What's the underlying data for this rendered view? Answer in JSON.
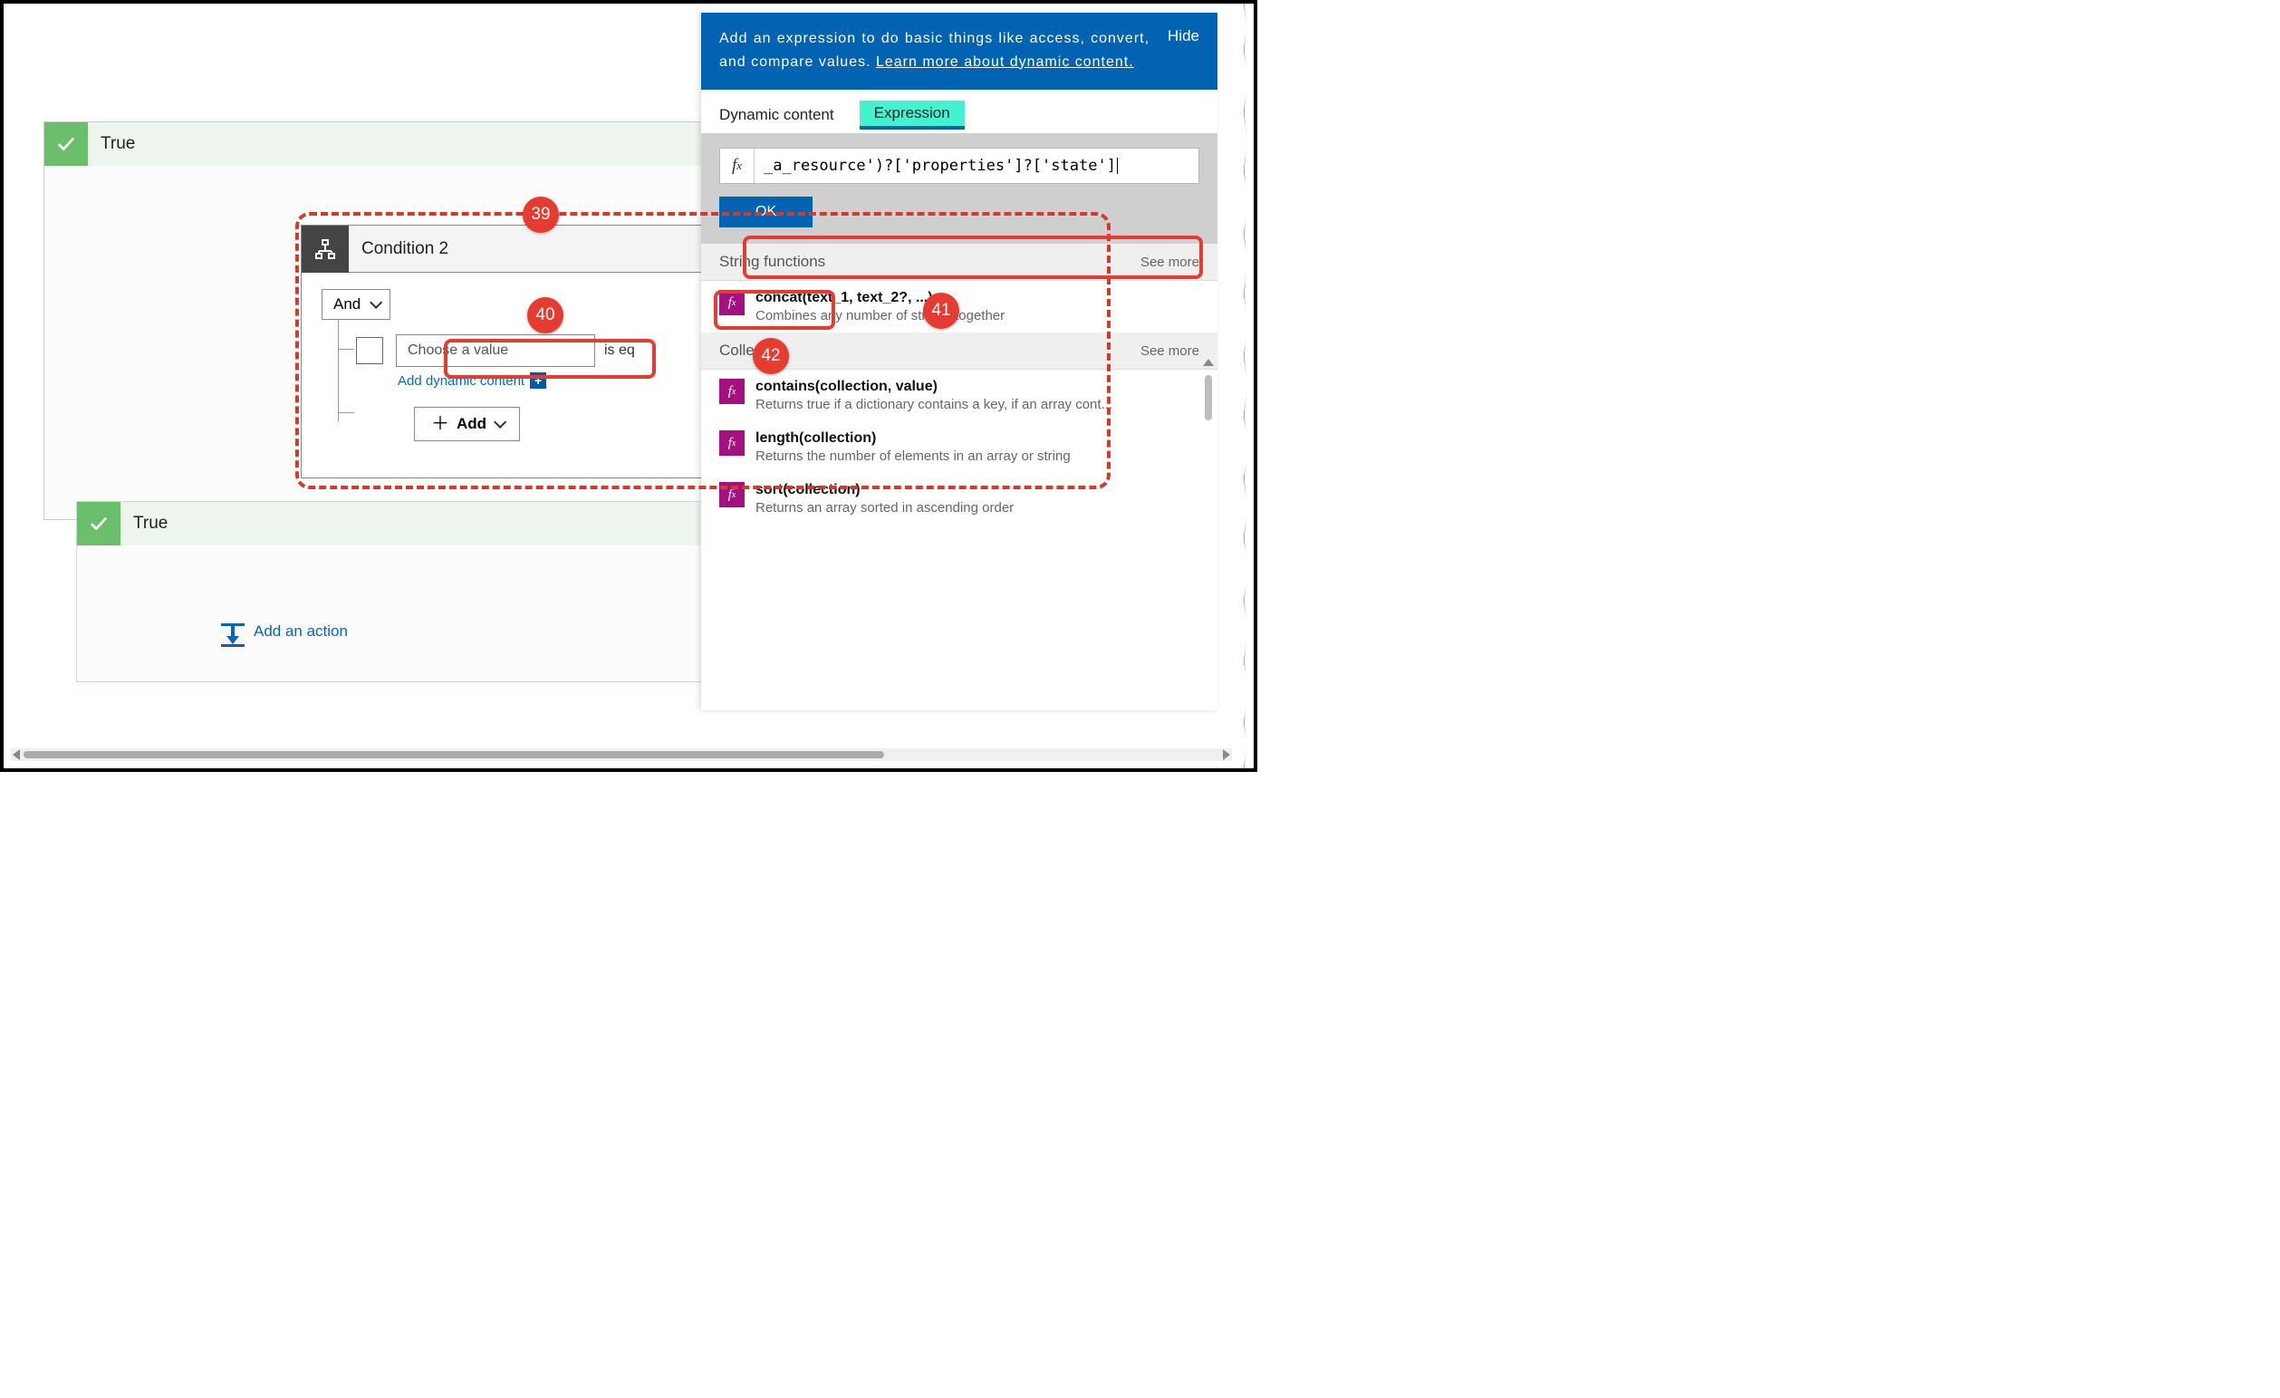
{
  "true_block_1": {
    "label": "True"
  },
  "true_block_2": {
    "label": "True"
  },
  "condition": {
    "title": "Condition 2",
    "operator": "And",
    "choose_placeholder": "Choose a value",
    "comparison": "is eq",
    "add_dynamic": "Add dynamic content",
    "add_button": "Add"
  },
  "add_action": {
    "label": "Add an action"
  },
  "flyout": {
    "description": "Add an expression to do basic things like access, convert, and compare values.",
    "learn_more": "Learn more about dynamic content.",
    "hide": "Hide",
    "tabs": {
      "dynamic": "Dynamic content",
      "expression": "Expression"
    },
    "fx_label": "fx",
    "expression_value": "_a_resource')?['properties']?['state']",
    "ok": "OK",
    "groups": [
      {
        "name": "String functions",
        "see_more": "See more",
        "items": [
          {
            "sig": "concat(text_1, text_2?, ...)",
            "desc": "Combines any number of strings together"
          }
        ]
      },
      {
        "name": "Collection",
        "see_more": "See more",
        "items": [
          {
            "sig": "contains(collection, value)",
            "desc": "Returns true if a dictionary contains a key, if an array cont..."
          },
          {
            "sig": "length(collection)",
            "desc": "Returns the number of elements in an array or string"
          },
          {
            "sig": "sort(collection)",
            "desc": "Returns an array sorted in ascending order"
          }
        ]
      }
    ]
  },
  "badges": {
    "b39": "39",
    "b40": "40",
    "b41": "41",
    "b42": "42"
  }
}
